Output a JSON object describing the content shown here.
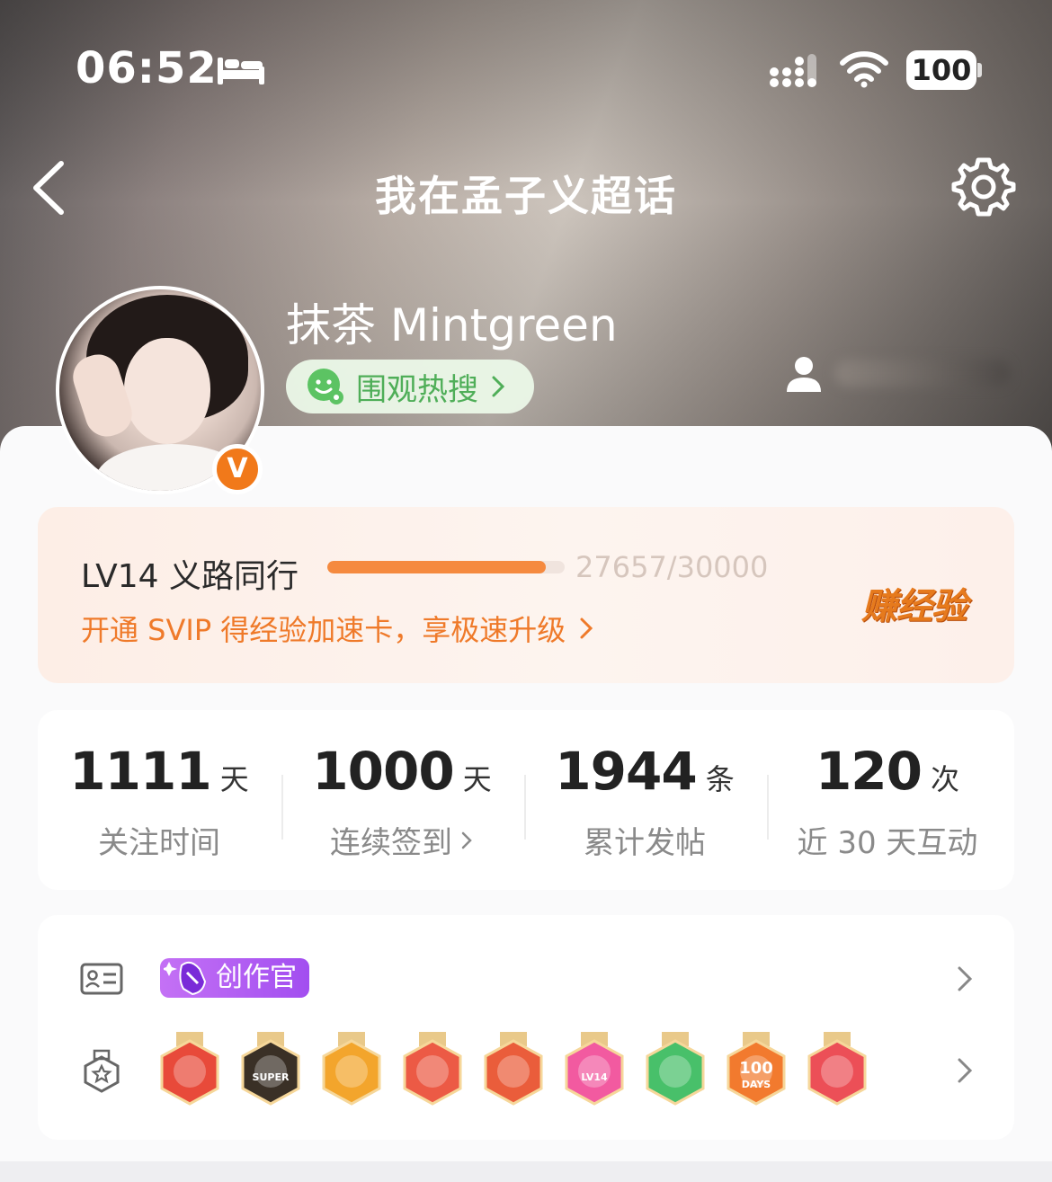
{
  "status_bar": {
    "time": "06:52",
    "battery": "100"
  },
  "nav": {
    "title": "我在孟子义超话"
  },
  "profile": {
    "name": "抹茶 Mintgreen",
    "hot_search_label": "围观热搜",
    "verified_badge": "V"
  },
  "level": {
    "title": "LV14 义路同行",
    "progress_text": "27657/30000",
    "progress_fraction": 0.9219,
    "svip_text": "开通 SVIP 得经验加速卡，享极速升级",
    "earn_label": "赚经验"
  },
  "stats": [
    {
      "value": "1111",
      "unit": "天",
      "label": "关注时间",
      "has_arrow": false
    },
    {
      "value": "1000",
      "unit": "天",
      "label": "连续签到",
      "has_arrow": true
    },
    {
      "value": "1944",
      "unit": "条",
      "label": "累计发帖",
      "has_arrow": false
    },
    {
      "value": "120",
      "unit": "次",
      "label": "近 30 天互动",
      "has_arrow": false
    }
  ],
  "badges": {
    "creator_tag": "创作官",
    "medals": [
      {
        "name": "cat-mascot-medal-icon",
        "color": "#e84a3a"
      },
      {
        "name": "super-crown-medal-icon",
        "color": "#3a3026"
      },
      {
        "name": "gold-crown-medal-icon",
        "color": "#f3a52c"
      },
      {
        "name": "cat-red-medal-icon",
        "color": "#ec5a45"
      },
      {
        "name": "dragon-cat-medal-icon",
        "color": "#ea5d3b"
      },
      {
        "name": "lv14-medal-icon",
        "color": "#f25aa0"
      },
      {
        "name": "hand-medal-icon",
        "color": "#48c06a"
      },
      {
        "name": "100-days-medal-icon",
        "color": "#f27a2e"
      },
      {
        "name": "trophy-medal-icon",
        "color": "#ec4f57"
      }
    ],
    "medal_labels": {
      "super": "SUPER",
      "lv": "LV14",
      "days_num": "100",
      "days": "DAYS"
    }
  }
}
